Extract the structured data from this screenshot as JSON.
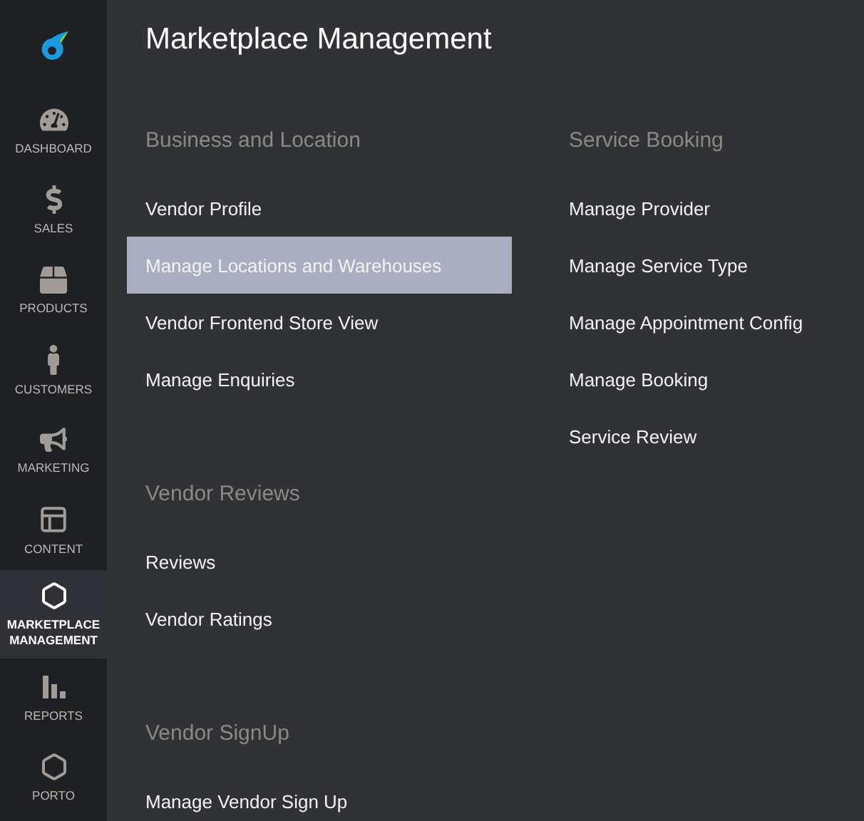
{
  "sidebar": {
    "items": [
      {
        "label": "DASHBOARD",
        "selected": false
      },
      {
        "label": "SALES",
        "selected": false
      },
      {
        "label": "PRODUCTS",
        "selected": false
      },
      {
        "label": "CUSTOMERS",
        "selected": false
      },
      {
        "label": "MARKETING",
        "selected": false
      },
      {
        "label": "CONTENT",
        "selected": false
      },
      {
        "label": "MARKETPLACE MANAGEMENT",
        "selected": true
      },
      {
        "label": "REPORTS",
        "selected": false
      },
      {
        "label": "PORTO",
        "selected": false
      }
    ]
  },
  "title": "Marketplace Management",
  "columns": [
    [
      {
        "heading": "Business and Location",
        "items": [
          {
            "label": "Vendor Profile",
            "selected": false
          },
          {
            "label": "Manage Locations and Warehouses",
            "selected": true
          },
          {
            "label": "Vendor Frontend Store View",
            "selected": false
          },
          {
            "label": "Manage Enquiries",
            "selected": false
          }
        ]
      },
      {
        "heading": "Vendor Reviews",
        "items": [
          {
            "label": "Reviews",
            "selected": false
          },
          {
            "label": "Vendor Ratings",
            "selected": false
          }
        ]
      },
      {
        "heading": "Vendor SignUp",
        "items": [
          {
            "label": "Manage Vendor Sign Up",
            "selected": false
          }
        ]
      }
    ],
    [
      {
        "heading": "Service Booking",
        "items": [
          {
            "label": "Manage Provider",
            "selected": false
          },
          {
            "label": "Manage Service Type",
            "selected": false
          },
          {
            "label": "Manage Appointment Config",
            "selected": false
          },
          {
            "label": "Manage Booking",
            "selected": false
          },
          {
            "label": "Service Review",
            "selected": false
          }
        ]
      }
    ]
  ]
}
